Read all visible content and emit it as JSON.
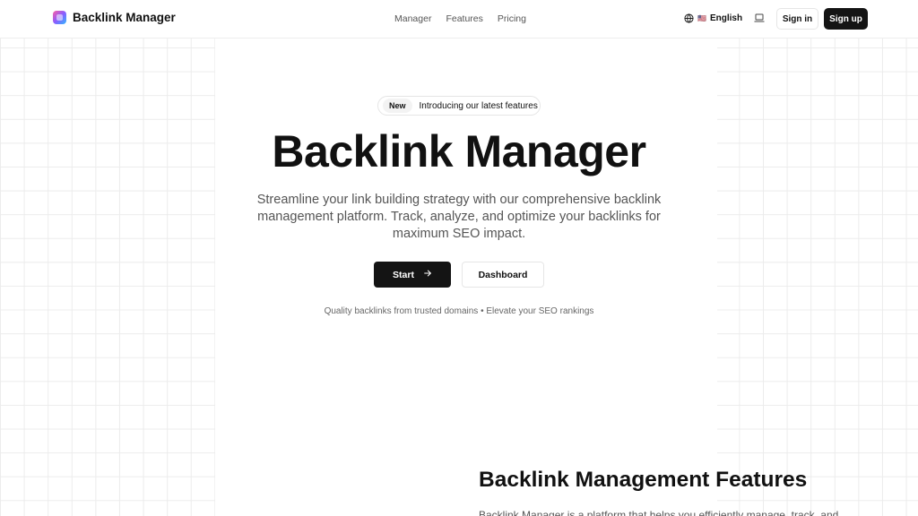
{
  "header": {
    "brand_name": "Backlink Manager",
    "nav": [
      "Manager",
      "Features",
      "Pricing"
    ],
    "language_label": "English",
    "language_flag": "🇺🇸",
    "sign_in": "Sign in",
    "sign_up": "Sign up",
    "icons": {
      "logo": "backlink-logo",
      "globe": "globe-icon",
      "theme": "laptop-icon"
    }
  },
  "hero": {
    "badge": "New",
    "announcement": "Introducing our latest features",
    "title": "Backlink Manager",
    "subtitle": "Streamline your link building strategy with our comprehensive backlink management platform. Track, analyze, and optimize your backlinks for maximum SEO impact.",
    "primary_button": "Start",
    "secondary_button": "Dashboard",
    "tagline": "Quality backlinks from trusted domains • Elevate your SEO rankings"
  },
  "features": {
    "title": "Backlink Management Features",
    "intro": "Backlink Manager is a platform that helps you efficiently manage, track, and"
  },
  "colors": {
    "primary": "#141414",
    "text": "#111111",
    "muted": "#555555",
    "border": "#e6e6e6",
    "grid": "#ececec"
  }
}
